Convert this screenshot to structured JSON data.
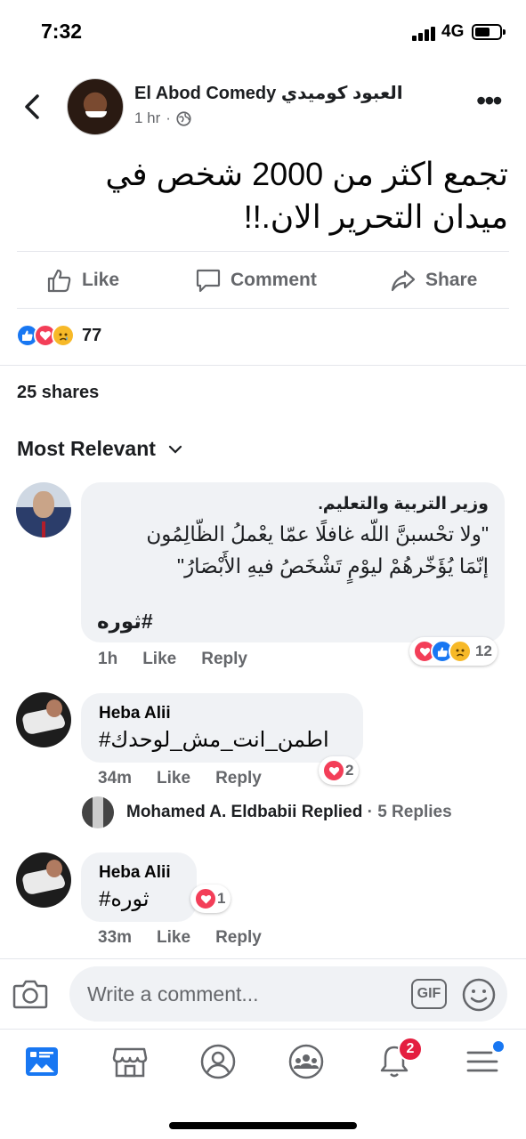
{
  "status_bar": {
    "time": "7:32",
    "network": "4G"
  },
  "post": {
    "page_name": "El Abod Comedy العبود كوميدي",
    "time": "1 hr",
    "privacy": "·",
    "text": "تجمع اكثر من 2000 شخص في ميدان التحرير الان.!!",
    "actions": {
      "like": "Like",
      "comment": "Comment",
      "share": "Share"
    },
    "reaction_count": "77",
    "shares": "25 shares"
  },
  "comments_filter": "Most Relevant",
  "comments": [
    {
      "line1": "وزير التربية والتعليم.",
      "line2": "\"ولا تحْسبنَّ اللّه غافلًا عمّا يعْملُ الظّالِمُون",
      "line3": "إنّمَا يُؤَخّرهُمْ ليوْمٍ تَشْخَصُ فيهِ الأَبْصَارُ\"",
      "hashtag": "#ثوره",
      "time": "1h",
      "like": "Like",
      "reply": "Reply",
      "reactions": "12"
    },
    {
      "author": "Heba Alii",
      "text": "#اطمن_انت_مش_لوحدك",
      "time": "34m",
      "like": "Like",
      "reply": "Reply",
      "reactions": "2",
      "replied_by": "Mohamed A. Eldbabii Replied",
      "replies": "· 5 Replies"
    },
    {
      "author": "Heba Alii",
      "text": "#ثوره",
      "time": "33m",
      "like": "Like",
      "reply": "Reply",
      "reactions": "1"
    }
  ],
  "composer": {
    "placeholder": "Write a comment...",
    "gif": "GIF"
  },
  "tabbar": {
    "notification_badge": "2"
  },
  "colors": {
    "like_blue": "#1877f2",
    "love_red": "#f33e58",
    "sad_yellow": "#f7b928",
    "grey_text": "#65676b"
  }
}
